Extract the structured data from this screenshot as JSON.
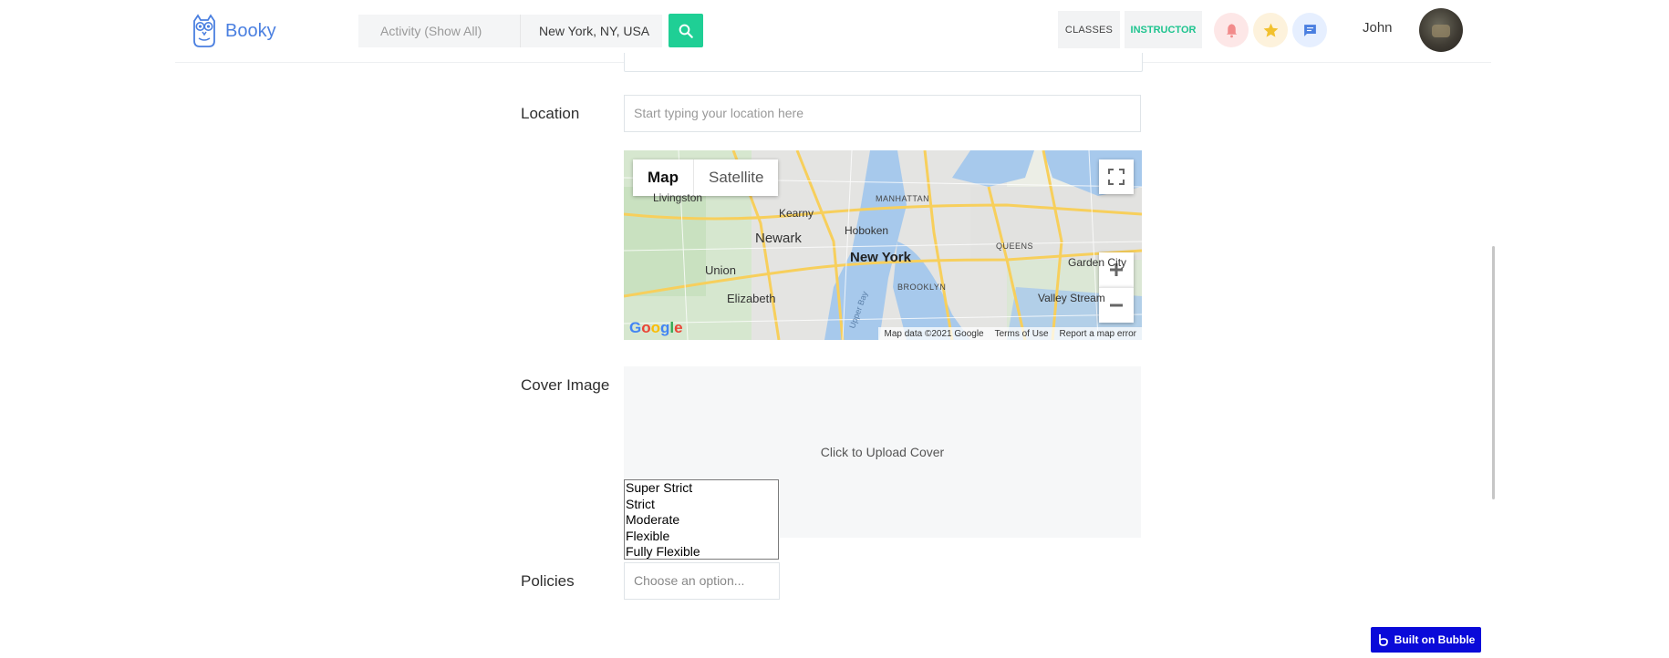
{
  "brand": {
    "name": "Booky",
    "color": "#4a7fe0"
  },
  "search": {
    "activity_placeholder": "Activity (Show All)",
    "location_value": "New York, NY, USA",
    "button_icon": "search-icon",
    "button_color": "#1fcf95"
  },
  "nav": {
    "classes_label": "CLASSES",
    "instructor_label": "INSTRUCTOR",
    "icons": [
      "bell-icon",
      "star-icon",
      "chat-icon"
    ],
    "user_name": "John"
  },
  "form": {
    "location_label": "Location",
    "location_placeholder": "Start typing your location here",
    "cover_label": "Cover Image",
    "cover_upload_text": "Click to Upload Cover",
    "policies_label": "Policies",
    "policies_placeholder": "Choose an option...",
    "policy_options": [
      "Super Strict",
      "Strict",
      "Moderate",
      "Flexible",
      "Fully Flexible"
    ]
  },
  "map": {
    "type_map": "Map",
    "type_satellite": "Satellite",
    "labels": {
      "livingston": "Livingston",
      "manhattan": "MANHATTAN",
      "kearny": "Kearny",
      "hoboken": "Hoboken",
      "newark": "Newark",
      "new_york": "New York",
      "queens": "QUEENS",
      "garden_city": "Garden City",
      "union": "Union",
      "brooklyn": "BROOKLYN",
      "elizabeth": "Elizabeth",
      "valley_stream": "Valley Stream",
      "upper_bay": "Upper Bay"
    },
    "google": "Google",
    "footer_data": "Map data ©2021 Google",
    "footer_terms": "Terms of Use",
    "footer_report": "Report a map error"
  },
  "badge": {
    "label": "Built on Bubble",
    "color": "#0a0ad9"
  }
}
